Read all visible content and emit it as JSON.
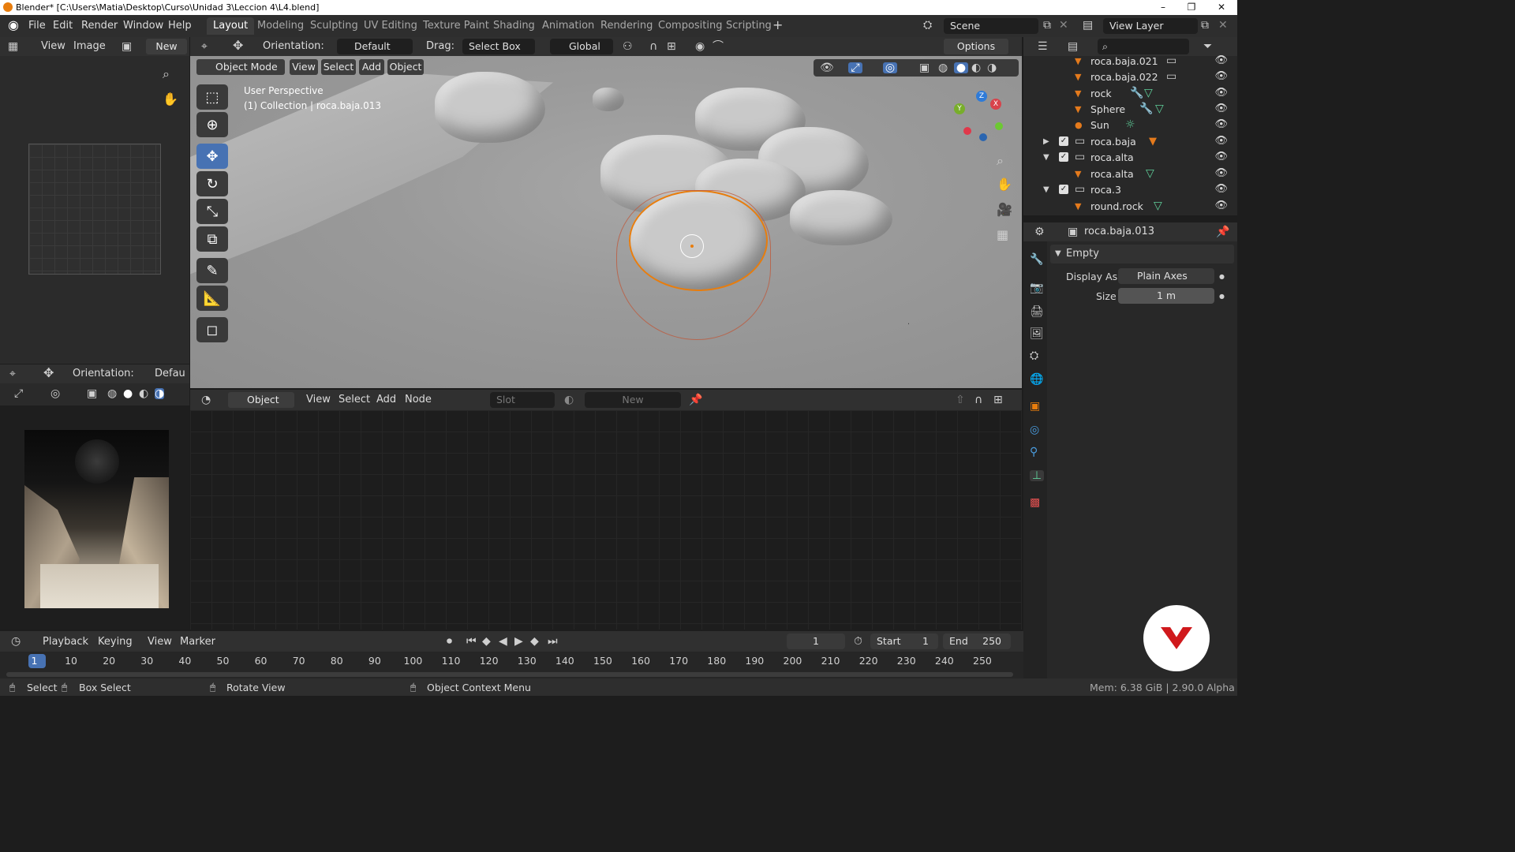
{
  "window": {
    "title": "Blender* [C:\\Users\\Matia\\Desktop\\Curso\\Unidad 3\\Leccion 4\\L4.blend]",
    "controls": [
      "–",
      "❐",
      "✕"
    ]
  },
  "menu": {
    "items": [
      "File",
      "Edit",
      "Render",
      "Window",
      "Help"
    ],
    "workspaces": [
      "Layout",
      "Modeling",
      "Sculpting",
      "UV Editing",
      "Texture Paint",
      "Shading",
      "Animation",
      "Rendering",
      "Compositing",
      "Scripting"
    ],
    "active_workspace": "Layout",
    "scene": "Scene",
    "view_layer": "View Layer"
  },
  "image_editor": {
    "view": "View",
    "image": "Image",
    "new": "New"
  },
  "tool_header": {
    "orientation_label": "Orientation:",
    "orientation_value": "Default",
    "drag_label": "Drag:",
    "drag_value": "Select Box",
    "transform": "Global",
    "options": "Options"
  },
  "viewport": {
    "mode": "Object Mode",
    "menus": [
      "View",
      "Select",
      "Add",
      "Object"
    ],
    "info_line1": "User Perspective",
    "info_line2": "(1) Collection | roca.baja.013",
    "gizmo": {
      "x": "X",
      "y": "Y",
      "z": "Z"
    }
  },
  "left_lower": {
    "orientation_label": "Orientation:",
    "orientation_value": "Defau"
  },
  "node_editor": {
    "object": "Object",
    "menus": [
      "View",
      "Select",
      "Add",
      "Node"
    ],
    "slot": "Slot",
    "new": "New"
  },
  "outliner": {
    "rows": [
      {
        "label": "roca.baja.021",
        "kind": "collection-item"
      },
      {
        "label": "roca.baja.022",
        "kind": "collection-item"
      },
      {
        "label": "rock",
        "kind": "mesh"
      },
      {
        "label": "Sphere",
        "kind": "mesh"
      },
      {
        "label": "Sun",
        "kind": "light"
      },
      {
        "label": "roca.baja",
        "kind": "collection"
      },
      {
        "label": "roca.alta",
        "kind": "collection"
      },
      {
        "label": "roca.alta",
        "kind": "mesh"
      },
      {
        "label": "roca.3",
        "kind": "collection"
      },
      {
        "label": "round.rock",
        "kind": "mesh"
      }
    ],
    "search_placeholder": ""
  },
  "properties": {
    "object_name": "roca.baja.013",
    "section": "Empty",
    "display_as_label": "Display As",
    "display_as_value": "Plain Axes",
    "size_label": "Size",
    "size_value": "1 m"
  },
  "timeline": {
    "menus": [
      "Playback",
      "Keying",
      "View",
      "Marker"
    ],
    "current_frame": "1",
    "start_label": "Start",
    "start_value": "1",
    "end_label": "End",
    "end_value": "250",
    "ticks": [
      "1",
      "10",
      "20",
      "30",
      "40",
      "50",
      "60",
      "70",
      "80",
      "90",
      "100",
      "110",
      "120",
      "130",
      "140",
      "150",
      "160",
      "170",
      "180",
      "190",
      "200",
      "210",
      "220",
      "230",
      "240",
      "250"
    ]
  },
  "statusbar": {
    "select": "Select",
    "box_select": "Box Select",
    "rotate_view": "Rotate View",
    "context_menu": "Object Context Menu",
    "info": "Mem: 6.38 GiB | 2.90.0 Alpha"
  },
  "colors": {
    "accent": "#4772b3",
    "selection": "#e87d0d",
    "logo": "#d0191c"
  }
}
